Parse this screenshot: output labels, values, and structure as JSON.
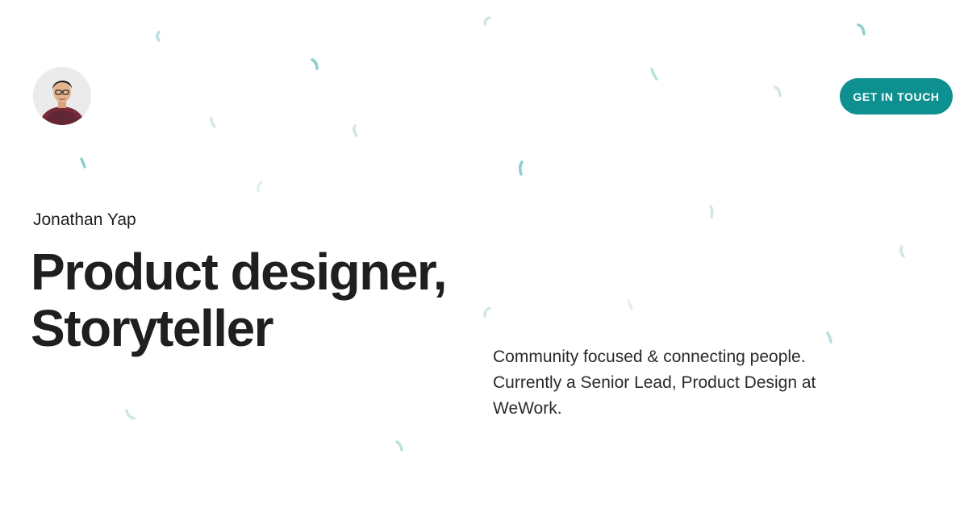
{
  "header": {
    "avatar_alt": "Jonathan Yap avatar",
    "cta_label": "GET IN TOUCH"
  },
  "hero": {
    "name": "Jonathan Yap",
    "headline_line1": "Product designer,",
    "headline_line2": "Storyteller",
    "bio": "Community focused & connecting people. Currently a Senior Lead, Product Design at WeWork."
  },
  "colors": {
    "accent": "#0e9090",
    "confetti": "#8ecfcb",
    "text": "#1f1f1f",
    "background": "#ffffff"
  }
}
